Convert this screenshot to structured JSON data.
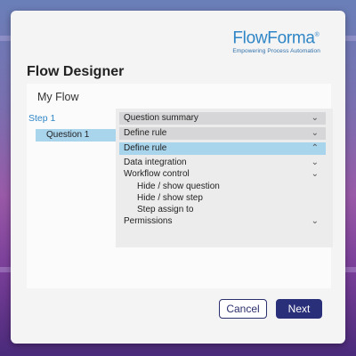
{
  "brand": {
    "name": "FlowForma",
    "trademark": "®",
    "tagline": "Empowering Process Automation"
  },
  "title": "Flow Designer",
  "flow_name": "My Flow",
  "steps": [
    {
      "label": "Step 1",
      "questions": [
        "Question 1"
      ]
    }
  ],
  "sections": {
    "question_summary": "Question summary",
    "define_rule_collapsed": "Define rule",
    "define_rule_expanded": "Define rule",
    "data_integration": "Data integration",
    "workflow_control": "Workflow control",
    "hide_show_question": "Hide / show question",
    "hide_show_step": "Hide / show step",
    "step_assign_to": "Step assign to",
    "permissions": "Permissions"
  },
  "icons": {
    "expand": "chevron-down-icon",
    "collapse": "chevron-up-icon"
  },
  "buttons": {
    "cancel": "Cancel",
    "next": "Next"
  },
  "colors": {
    "accent": "#2f86c6",
    "selected": "#a8d4ec",
    "primary_button": "#2a2f7a"
  }
}
